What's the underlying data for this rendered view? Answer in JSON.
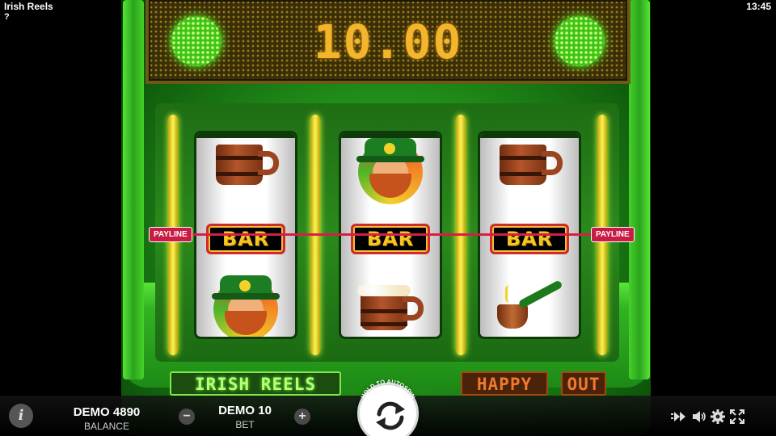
{
  "header": {
    "title": "Irish Reels",
    "help": "?",
    "clock": "13:45"
  },
  "display": {
    "win_value": "10.00"
  },
  "reels": [
    {
      "top": "mug",
      "middle": "BAR",
      "bottom": "leprechaun"
    },
    {
      "top": "leprechaun",
      "middle": "BAR",
      "bottom": "mug"
    },
    {
      "top": "mug",
      "middle": "BAR",
      "bottom": "pipe"
    }
  ],
  "payline": {
    "left_label": "PAYLINE",
    "right_label": "PAYLINE",
    "color": "#d42046"
  },
  "cabinet_labels": {
    "game_name": "IRISH REELS",
    "happy": "HAPPY",
    "out": "OUT"
  },
  "bottom_bar": {
    "info_icon": "info-icon",
    "balance_value": "DEMO 4890",
    "balance_caption": "BALANCE",
    "bet_decrease": "−",
    "bet_value": "DEMO 10",
    "bet_caption": "BET",
    "bet_increase": "+",
    "autospin_hint": "HOLD TO AUTOSPIN",
    "spin_icon": "spin-icon",
    "right_icons": [
      "turbo-icon",
      "sound-icon",
      "settings-icon",
      "fullscreen-icon"
    ]
  },
  "colors": {
    "cabinet_green": "#2aa41c",
    "display_digits": "#f2b52c",
    "reel_divider": "#fff35a"
  }
}
